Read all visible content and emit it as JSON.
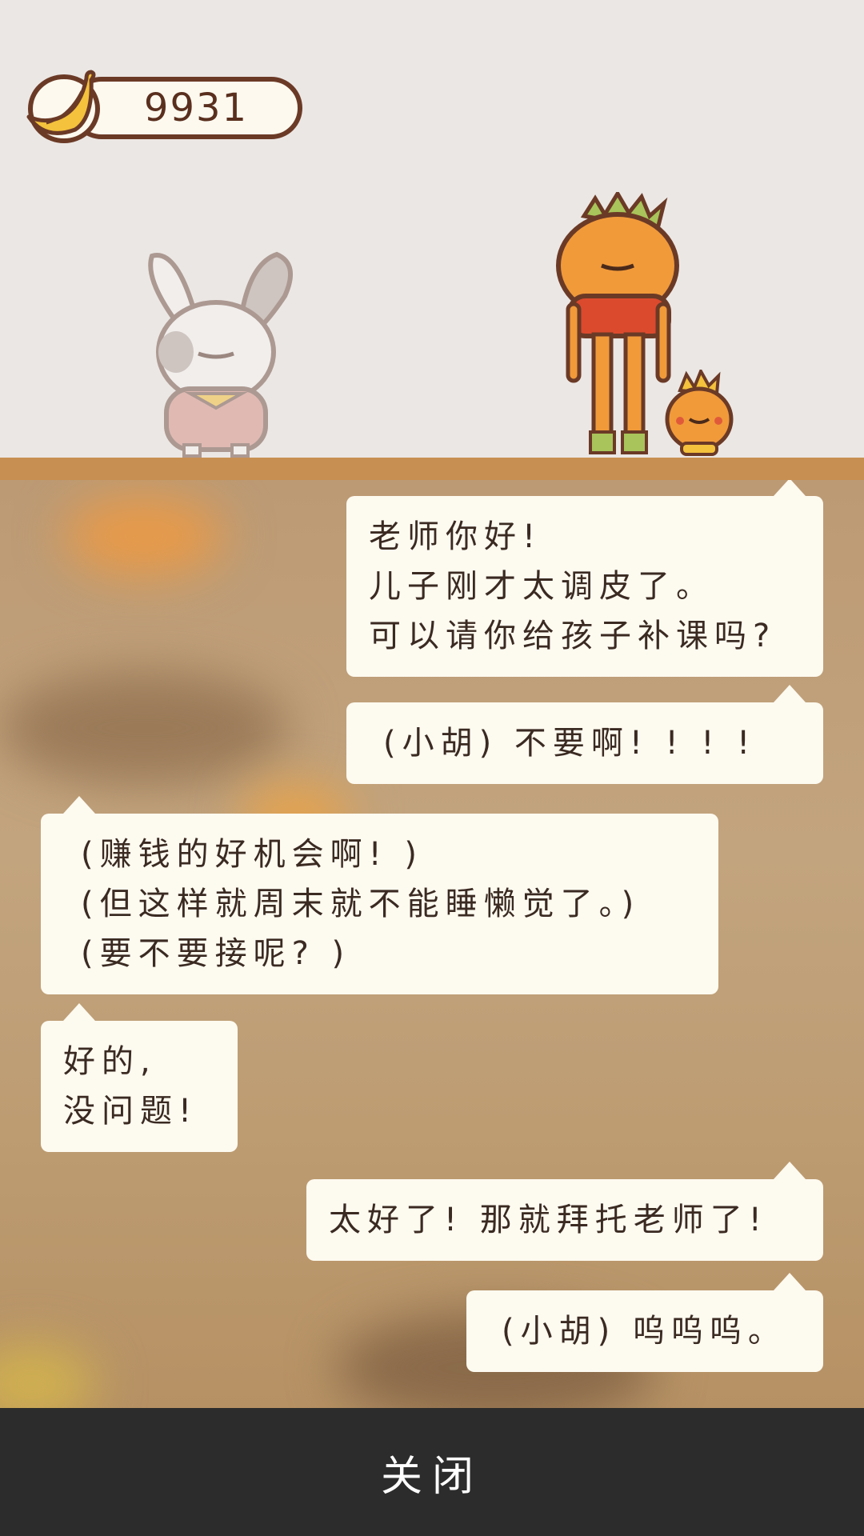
{
  "currency": {
    "icon": "banana-icon",
    "amount": "9931"
  },
  "characters": [
    "rabbit-character",
    "pumpkin-parent-character",
    "pumpkin-child-character"
  ],
  "dialogue": [
    {
      "speaker": "parent",
      "side": "right",
      "lines": [
        "老师你好!",
        "儿子刚才太调皮了。",
        "可以请你给孩子补课吗?"
      ]
    },
    {
      "speaker": "child",
      "side": "right",
      "lines": [
        "(小胡) 不要啊! ! ! !"
      ]
    },
    {
      "speaker": "player",
      "side": "left",
      "lines": [
        "(赚钱的好机会啊! )",
        "(但这样就周末就不能睡懒觉了。)",
        "(要不要接呢? )"
      ]
    },
    {
      "speaker": "player",
      "side": "left",
      "lines": [
        "好的,",
        "没问题!"
      ]
    },
    {
      "speaker": "parent",
      "side": "right",
      "lines": [
        "太好了! 那就拜托老师了!"
      ]
    },
    {
      "speaker": "child",
      "side": "right",
      "lines": [
        "(小胡) 呜呜呜。"
      ]
    }
  ],
  "footer": {
    "close_label": "关闭"
  },
  "colors": {
    "background": "#ebe7e4",
    "floor": "#c88f52",
    "bubble": "#fdfaf0",
    "text": "#3a2a22",
    "footer": "#2c2c2c",
    "outline": "#6b3a26"
  }
}
